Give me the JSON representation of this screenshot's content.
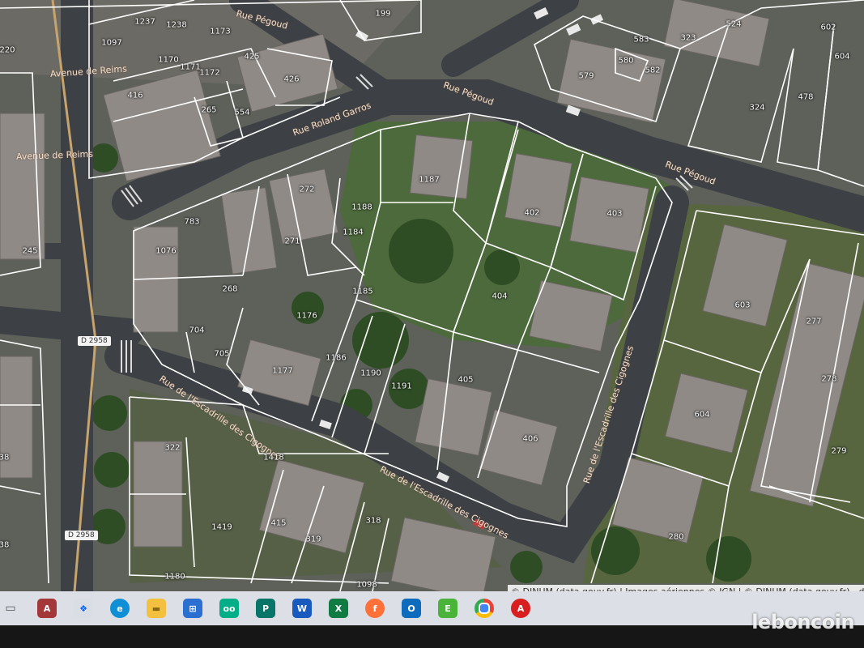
{
  "map": {
    "road_labels": {
      "rue_pegoud_1": "Rue Pégoud",
      "rue_pegoud_2": "Rue Pégoud",
      "rue_pegoud_3": "Rue Pégoud",
      "rue_roland_garros": "Rue Roland Garros",
      "avenue_de_reims_1": "Avenue de Reims",
      "avenue_de_reims_2": "Avenue de Reims",
      "escadrille_1": "Rue de l'Escadrille des Cigognes",
      "escadrille_2": "Rue de l'Escadrille des Cigognes",
      "escadrille_3": "Rue de l'Escadrille des Cigognes"
    },
    "road_badges": {
      "d2958_1": "D 2958",
      "d2958_2": "D 2958"
    },
    "parcels": {
      "p1237": "1237",
      "p1238": "1238",
      "p1173": "1173",
      "p1097": "1097",
      "p199": "199",
      "p220": "220",
      "p1170": "1170",
      "p1171": "1171",
      "p1172": "1172",
      "p425": "425",
      "p426": "426",
      "p416": "416",
      "p265": "265",
      "p554": "554",
      "p583": "583",
      "p323": "323",
      "p524": "524",
      "p602": "602",
      "p604top": "604",
      "p580": "580",
      "p582": "582",
      "p579": "579",
      "p324": "324",
      "p478": "478",
      "p1187": "1187",
      "p272": "272",
      "p1188": "1188",
      "p783": "783",
      "p271": "271",
      "p1184": "1184",
      "p1076": "1076",
      "p268": "268",
      "p1185": "1185",
      "p245": "245",
      "p402": "402",
      "p403": "403",
      "p404": "404",
      "p603": "603",
      "p277": "277",
      "p278": "278",
      "p1176": "1176",
      "p704": "704",
      "p705": "705",
      "p1186": "1186",
      "p1177": "1177",
      "p1190": "1190",
      "p1191": "1191",
      "p405": "405",
      "p406": "406",
      "p604": "604",
      "p279": "279",
      "p322": "322",
      "p1418": "1418",
      "p415": "415",
      "p318": "318",
      "p1419": "1419",
      "p319": "319",
      "p280": "280",
      "p1180": "1180",
      "p1098": "1098",
      "p38a": "38",
      "p38b": "38"
    },
    "attribution": "© DINUM (data.gouv.fr) | Images aériennes © IGN | © DINUM (data.gouv.fr) - déce"
  },
  "taskbar": {
    "apps": [
      "windows-start",
      "access",
      "dropbox",
      "edge",
      "file-explorer",
      "store",
      "tripadvisor",
      "publisher",
      "word",
      "excel",
      "firefox",
      "outlook",
      "evernote",
      "chrome",
      "acrobat"
    ],
    "colors": {
      "access": "#a4373a",
      "dropbox": "#0061fe",
      "edge": "#0f8fd6",
      "file-explorer": "#f3c03f",
      "store": "#2b6fd1",
      "tripadvisor": "#00af87",
      "publisher": "#077568",
      "word": "#185abd",
      "excel": "#107c41",
      "firefox": "#ff7139",
      "outlook": "#0f6cbd",
      "evernote": "#4ab43a",
      "chrome": "#4285f4",
      "acrobat": "#d81e1e"
    }
  },
  "watermark": "leboncoin"
}
